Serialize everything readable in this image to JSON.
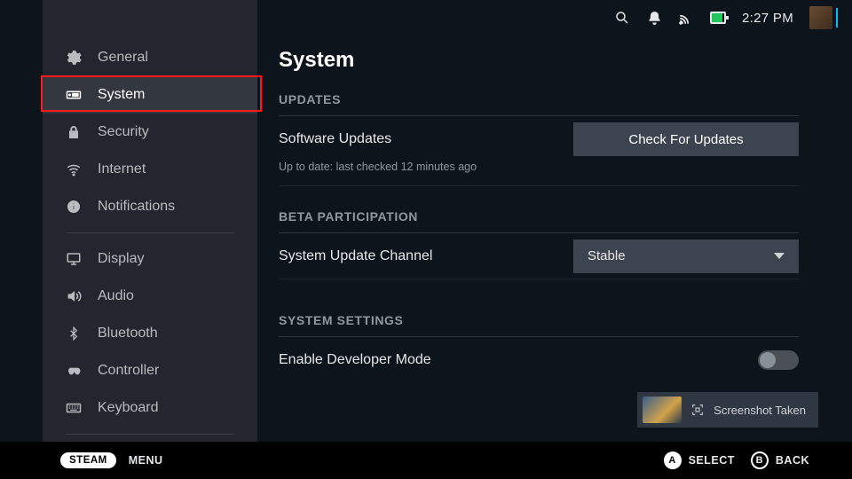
{
  "status": {
    "clock": "2:27 PM",
    "icons": {
      "search": "search-icon",
      "bell": "bell-icon",
      "cast": "cast-icon",
      "battery": "battery-icon",
      "avatar": "avatar"
    }
  },
  "sidebar": {
    "groups": [
      [
        {
          "icon": "gear-icon",
          "label": "General"
        },
        {
          "icon": "device-icon",
          "label": "System",
          "active": true
        },
        {
          "icon": "lock-icon",
          "label": "Security"
        },
        {
          "icon": "wifi-icon",
          "label": "Internet"
        },
        {
          "icon": "info-icon",
          "label": "Notifications"
        }
      ],
      [
        {
          "icon": "display-icon",
          "label": "Display"
        },
        {
          "icon": "audio-icon",
          "label": "Audio"
        },
        {
          "icon": "bluetooth-icon",
          "label": "Bluetooth"
        },
        {
          "icon": "controller-icon",
          "label": "Controller"
        },
        {
          "icon": "keyboard-icon",
          "label": "Keyboard"
        }
      ]
    ]
  },
  "page": {
    "title": "System",
    "sections": {
      "updates_heading": "UPDATES",
      "software_updates_label": "Software Updates",
      "check_updates_button": "Check For Updates",
      "updates_status": "Up to date: last checked 12 minutes ago",
      "beta_heading": "BETA PARTICIPATION",
      "channel_label": "System Update Channel",
      "channel_value": "Stable",
      "system_settings_heading": "SYSTEM SETTINGS",
      "dev_mode_label": "Enable Developer Mode",
      "dev_mode_on": false
    }
  },
  "toast": {
    "label": "Screenshot Taken"
  },
  "footer": {
    "steam_pill": "STEAM",
    "menu_label": "MENU",
    "hints": {
      "a": "A",
      "a_label": "SELECT",
      "b": "B",
      "b_label": "BACK"
    }
  }
}
